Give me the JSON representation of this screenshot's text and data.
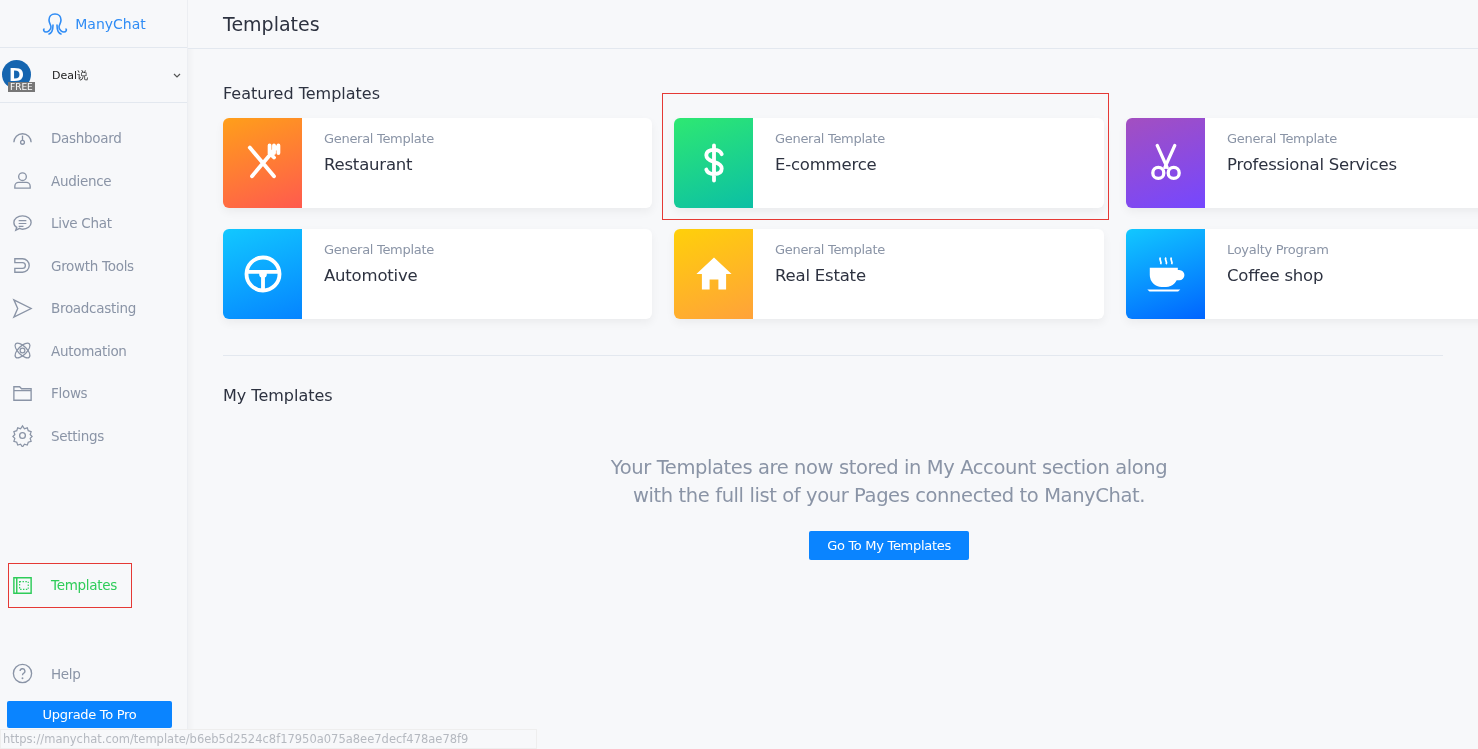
{
  "sidebar": {
    "brand": "ManyChat",
    "account": {
      "avatar_letter": "D",
      "plan": "FREE",
      "name": "Deal说"
    },
    "items": [
      {
        "label": "Dashboard",
        "kind": "dashboard",
        "selected": false,
        "highlighted": false
      },
      {
        "label": "Audience",
        "kind": "audience",
        "selected": false,
        "highlighted": false
      },
      {
        "label": "Live Chat",
        "kind": "chat",
        "selected": false,
        "highlighted": false
      },
      {
        "label": "Growth Tools",
        "kind": "magnet",
        "selected": false,
        "highlighted": false
      },
      {
        "label": "Broadcasting",
        "kind": "send",
        "selected": false,
        "highlighted": false
      },
      {
        "label": "Automation",
        "kind": "atom",
        "selected": false,
        "highlighted": false
      },
      {
        "label": "Flows",
        "kind": "folder",
        "selected": false,
        "highlighted": false
      },
      {
        "label": "Settings",
        "kind": "gear",
        "selected": false,
        "highlighted": false
      }
    ],
    "bottom_items": [
      {
        "label": "Templates",
        "kind": "template",
        "selected": true,
        "highlighted": true
      },
      {
        "label": "Help",
        "kind": "help",
        "selected": false,
        "highlighted": false
      }
    ],
    "upgrade_button": "Upgrade To Pro"
  },
  "header": {
    "title": "Templates"
  },
  "featured": {
    "title": "Featured Templates",
    "cards": [
      {
        "category": "General Template",
        "name": "Restaurant",
        "kind": "cutlery",
        "color": "#ff5a4e",
        "highlighted": false
      },
      {
        "category": "General Template",
        "name": "E-commerce",
        "kind": "dollar",
        "color": "#0bbfa5",
        "highlighted": true
      },
      {
        "category": "General Template",
        "name": "Professional Services",
        "kind": "scissors",
        "color": "#7547ff",
        "highlighted": false
      },
      {
        "category": "General Template",
        "name": "Automotive",
        "kind": "wheel",
        "color": "#0584ff",
        "highlighted": false
      },
      {
        "category": "General Template",
        "name": "Real Estate",
        "kind": "house",
        "color": "#ffa23a",
        "highlighted": false
      },
      {
        "category": "Loyalty Program",
        "name": "Coffee shop",
        "kind": "cup",
        "color": "#0064ff",
        "highlighted": false
      }
    ]
  },
  "my_templates": {
    "title": "My Templates",
    "message": "Your Templates are now stored in My Account section along with the full list of your Pages connected to ManyChat.",
    "button": "Go To My Templates"
  },
  "status_url": "https://manychat.com/template/b6eb5d2524c8f17950a075a8ee7decf478ae78f9"
}
